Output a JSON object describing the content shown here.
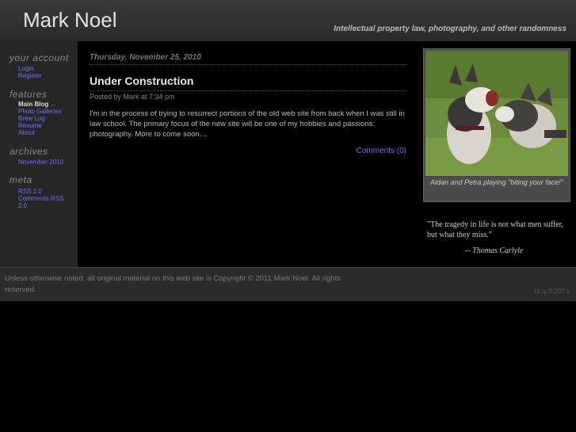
{
  "header": {
    "title": "Mark Noel",
    "tagline": "Intellectual property law, photography, and other randomness"
  },
  "sidebar": {
    "account": {
      "heading": "your account",
      "items": [
        {
          "label": "Login"
        },
        {
          "label": "Register"
        }
      ]
    },
    "features": {
      "heading": "features",
      "current": "Main Blog",
      "arrow": "←",
      "items": [
        {
          "label": "Photo Galleries"
        },
        {
          "label": "Brew Log"
        },
        {
          "label": "Resume"
        },
        {
          "label": "About"
        }
      ]
    },
    "archives": {
      "heading": "archives",
      "items": [
        {
          "label": "November 2010"
        }
      ]
    },
    "meta": {
      "heading": "meta",
      "items": [
        {
          "label": "RSS 2.0"
        },
        {
          "label": "Comments"
        },
        {
          "label": "RSS 2.0"
        }
      ]
    }
  },
  "post": {
    "date": "Thursday, November 25, 2010",
    "title": "Under Construction",
    "meta": "Posted by Mark at 7:34 pm",
    "body": "I'm in the process of trying to resurrect portions of the old web site from back when I was still in law school.  The primary focus of the new site will be one of my hobbies and passions: photography.  More to come soon…",
    "comments_link": "Comments (0)"
  },
  "photo": {
    "caption": "Aidan and Petra playing \"biting your face!\""
  },
  "quote": {
    "text": "\"The tragedy in life is not what men suffer, but what they miss.\"",
    "author": "-- Thomas Carlyle"
  },
  "footer": {
    "copyright": "Unless otherwise noted, all original material on this web site is Copyright © 2011 Mark Noel. All rights reserved.",
    "stats": "11 q, 0.207 s"
  }
}
